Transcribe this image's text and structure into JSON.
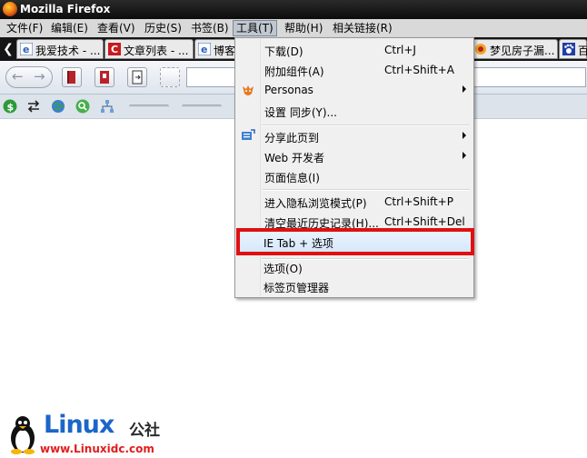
{
  "window": {
    "title": "Mozilla Firefox"
  },
  "menubar": {
    "items": [
      "文件(F)",
      "编辑(E)",
      "查看(V)",
      "历史(S)",
      "书签(B)",
      "工具(T)",
      "帮助(H)",
      "相关链接(R)"
    ],
    "active": "工具(T)"
  },
  "tabs": [
    {
      "label": "我爱技术 - ...",
      "icon": "ie-icon"
    },
    {
      "label": "文章列表 - ...",
      "icon": "csdn-icon"
    },
    {
      "label": "博客",
      "icon": "ie-icon"
    },
    {
      "label": "梦见房子漏...",
      "icon": "logo-icon"
    },
    {
      "label": "百",
      "icon": "paw-icon"
    }
  ],
  "tools_menu": {
    "items": [
      {
        "label": "下载(D)",
        "shortcut": "Ctrl+J"
      },
      {
        "label": "附加组件(A)",
        "shortcut": "Ctrl+Shift+A"
      },
      {
        "label": "Personas",
        "submenu": true,
        "icon": "personas-icon"
      },
      {
        "label": "设置 同步(Y)..."
      },
      {
        "label": "分享此页到",
        "submenu": true,
        "icon": "share-icon"
      },
      {
        "label": "Web 开发者",
        "submenu": true
      },
      {
        "label": "页面信息(I)"
      },
      {
        "label": "进入隐私浏览模式(P)",
        "shortcut": "Ctrl+Shift+P"
      },
      {
        "label": "清空最近历史记录(H)...",
        "shortcut": "Ctrl+Shift+Del"
      },
      {
        "label": "IE Tab + 选项",
        "highlighted": true
      },
      {
        "label": "选项(O)"
      },
      {
        "label": "标签页管理器"
      }
    ]
  },
  "watermark": {
    "brand": "Linux",
    "brand_cn": "公社",
    "url": "www.Linuxidc.com"
  },
  "colors": {
    "highlight_border": "#e01010",
    "brand_blue": "#1b66c9",
    "url_red": "#e21d1d"
  }
}
